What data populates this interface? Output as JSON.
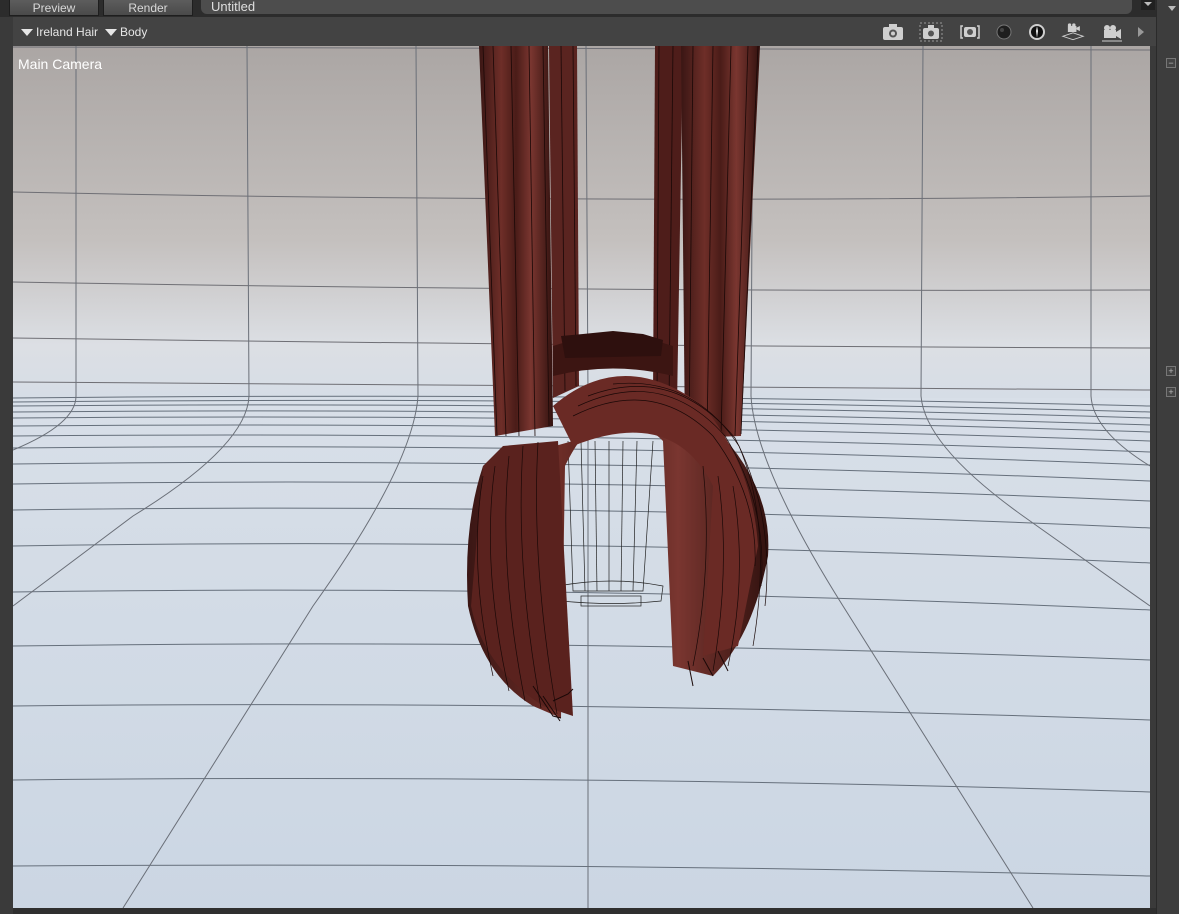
{
  "tabs": [
    {
      "label": "Preview"
    },
    {
      "label": "Render"
    }
  ],
  "scene_title": "Untitled",
  "toolbar": {
    "node_selector": "Ireland Hair",
    "node_selector_icon": "triangle-down-icon",
    "sub_selector": "Body",
    "sub_selector_icon": "triangle-down-icon",
    "tools": [
      {
        "name": "camera-icon"
      },
      {
        "name": "camera-frame-icon"
      },
      {
        "name": "camera-lens-icon"
      },
      {
        "name": "sphere-icon"
      },
      {
        "name": "lighting-sphere-icon"
      },
      {
        "name": "camera-platform-icon"
      },
      {
        "name": "video-camera-icon"
      },
      {
        "name": "play-arrow-icon"
      }
    ]
  },
  "viewport": {
    "camera_label": "Main Camera",
    "background_top": "#aba6a4",
    "floor_color": "#cdd8e4",
    "hair_color": "#5a2420"
  },
  "right_panel": {
    "collapse_symbol": "−",
    "expand_symbol": "+"
  }
}
